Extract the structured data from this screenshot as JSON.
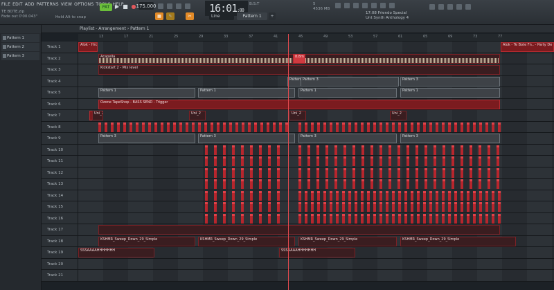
{
  "menu": [
    "FILE",
    "EDIT",
    "ADD",
    "PATTERNS",
    "VIEW",
    "OPTIONS",
    "TOOLS",
    "HELP"
  ],
  "hint": {
    "line1": "TE BOTE.zip",
    "line2": "Fade out  0'00.043\"",
    "snap": "Hold Alt to snap"
  },
  "transport": {
    "pat_song": "PAT",
    "tempo": "175.000",
    "clock": "16:01",
    "clock_sub": ":00",
    "bst": "B:S:T"
  },
  "toolbar": {
    "snap_mode": "Line",
    "pattern": "Pattern 1",
    "mem": "4536 MB",
    "cpu": "5"
  },
  "recent": {
    "time": "17:08",
    "line1": "Friendo Special",
    "line2": "Unt Synth Anthology 4"
  },
  "sidebar": {
    "patterns": [
      "Pattern 1",
      "Pattern 2",
      "Pattern 3"
    ]
  },
  "playlist": {
    "title": "Playlist - Arrangement",
    "crumb": "Pattern 1"
  },
  "ruler": [
    13,
    17,
    21,
    25,
    29,
    33,
    37,
    41,
    45,
    49,
    53,
    57,
    61,
    65,
    69,
    73,
    77
  ],
  "tracks": [
    "Track 1",
    "Track 2",
    "Track 3",
    "Track 4",
    "Track 5",
    "Track 6",
    "Track 7",
    "Track 8",
    "Track 9",
    "Track 10",
    "Track 11",
    "Track 12",
    "Track 13",
    "Track 14",
    "Track 15",
    "Track 16",
    "Track 17",
    "Track 18",
    "Track 19",
    "Track 20",
    "Track 21"
  ],
  "clips": {
    "t1a": "Alok - Hrcl",
    "t1b": "Alok - Te Bote Fn.. - Party De Ven",
    "t2": "Acapella",
    "t2b": "8.8m",
    "t3": "Kickstart 2 - Mix level",
    "t4": "Pattern 3",
    "t5": "Pattern 1",
    "t6": "Ozone TapeShop - BASS SEND - Trigger",
    "t7": "Uni_2",
    "t9": "Pattern 3",
    "t18": "KSHMR_Sweep_Down_29_Simple",
    "t19": "SSSAAAAHHHHHHH"
  }
}
